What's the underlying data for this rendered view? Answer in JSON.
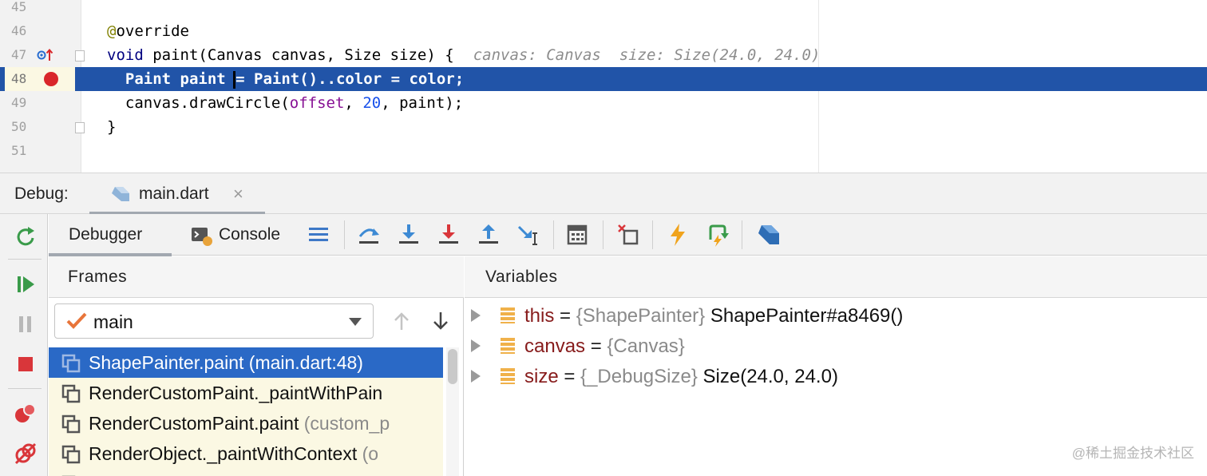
{
  "editor": {
    "lines": [
      {
        "num": "45",
        "segments": []
      },
      {
        "num": "46",
        "segments": [
          {
            "t": "@",
            "c": "kw-ann"
          },
          {
            "t": "override",
            "c": ""
          }
        ]
      },
      {
        "num": "47",
        "segments": [
          {
            "t": "void",
            "c": "kw"
          },
          {
            "t": " paint(Canvas canvas, Size size) {",
            "c": ""
          }
        ],
        "hint": "canvas: Canvas  size: Size(24.0, 24.0)"
      },
      {
        "num": "48",
        "segments": [
          {
            "t": "  Paint paint ",
            "c": ""
          },
          {
            "t": "= Paint()..color = color;",
            "c": ""
          }
        ],
        "current": true
      },
      {
        "num": "49",
        "segments": [
          {
            "t": "  canvas.drawCircle(",
            "c": ""
          },
          {
            "t": "offset",
            "c": "param"
          },
          {
            "t": ", ",
            "c": ""
          },
          {
            "t": "20",
            "c": "num"
          },
          {
            "t": ", paint);",
            "c": ""
          }
        ]
      },
      {
        "num": "50",
        "segments": [
          {
            "t": "}",
            "c": ""
          }
        ]
      },
      {
        "num": "51",
        "segments": []
      }
    ]
  },
  "debug": {
    "title": "Debug:",
    "session_tab": "main.dart",
    "close_glyph": "×"
  },
  "toolbar": {
    "debugger_tab": "Debugger",
    "console_tab": "Console"
  },
  "frames": {
    "title": "Frames",
    "thread": "main",
    "items": [
      {
        "name": "ShapePainter.paint",
        "location": " (main.dart:48)"
      },
      {
        "name": "RenderCustomPaint._paintWithPain",
        "location": ""
      },
      {
        "name": "RenderCustomPaint.paint",
        "location": " (custom_p"
      },
      {
        "name": "RenderObject._paintWithContext",
        "location": " (o"
      }
    ]
  },
  "variables": {
    "title": "Variables",
    "items": [
      {
        "name": "this",
        "eq": " = ",
        "type": "{ShapePainter}",
        "value": " ShapePainter#a8469()"
      },
      {
        "name": "canvas",
        "eq": " = ",
        "type": "{Canvas}",
        "value": ""
      },
      {
        "name": "size",
        "eq": " = ",
        "type": "{_DebugSize}",
        "value": " Size(24.0, 24.0)"
      }
    ]
  },
  "watermark": "@稀土掘金技术社区",
  "colors": {
    "current_line": "#2154a8",
    "selected_frame": "#2a69c6",
    "breakpoint": "#d9262a",
    "frames_background": "#fbf8e3",
    "variable_name": "#871b1b"
  }
}
